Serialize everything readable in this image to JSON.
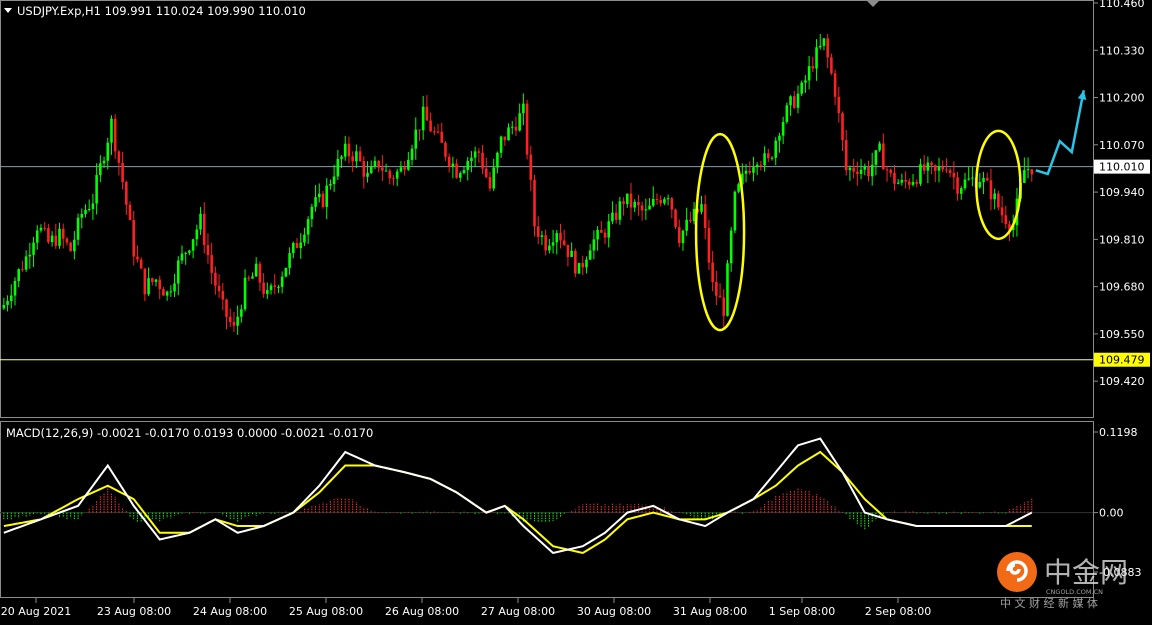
{
  "header": {
    "symbol_line": "USDJPY.Exp,H1  109.991 110.024 109.990 110.010"
  },
  "macd_header": "MACD(12,26,9) -0.0021 -0.0170 0.0193 0.0000 -0.0021 -0.0170",
  "watermark": {
    "brand": "中金网",
    "domain": "CNGOLD.COM.CN",
    "tagline": "中 文 财 经 新 媒 体"
  },
  "colors": {
    "background": "#000000",
    "bull_candle": "#00ff00",
    "bear_candle": "#ff2020",
    "macd_line": "#ffffff",
    "signal_line": "#ffff00",
    "hist_pos": "#ff3030",
    "hist_neg": "#00ff00",
    "ellipse": "#ffff00",
    "forecast_arrow": "#29c5e6",
    "price_line": "#7f9fb3",
    "support_line": "#ffff80"
  },
  "chart_data": [
    {
      "type": "candlestick",
      "title": "USDJPY.Exp,H1",
      "ohlc_last": {
        "open": 109.991,
        "high": 110.024,
        "low": 109.99,
        "close": 110.01
      },
      "ylim": [
        109.36,
        110.46
      ],
      "y_ticks": [
        "110.460",
        "110.330",
        "110.200",
        "110.070",
        "109.940",
        "109.810",
        "109.680",
        "109.550",
        "109.420"
      ],
      "x_ticks": [
        "20 Aug 2021",
        "23 Aug 08:00",
        "24 Aug 08:00",
        "25 Aug 08:00",
        "26 Aug 08:00",
        "27 Aug 08:00",
        "30 Aug 08:00",
        "31 Aug 08:00",
        "1 Sep 08:00",
        "2 Sep 08:00"
      ],
      "current_price": {
        "value": 110.01,
        "label": "110.010"
      },
      "support_level": {
        "value": 109.479,
        "label": "109.479"
      },
      "price_path": [
        [
          0,
          109.63
        ],
        [
          3,
          109.7
        ],
        [
          6,
          109.76
        ],
        [
          9,
          109.85
        ],
        [
          12,
          109.8
        ],
        [
          15,
          109.82
        ],
        [
          18,
          109.78
        ],
        [
          21,
          109.88
        ],
        [
          24,
          109.92
        ],
        [
          27,
          110.05
        ],
        [
          29,
          110.13
        ],
        [
          32,
          109.97
        ],
        [
          35,
          109.78
        ],
        [
          38,
          109.68
        ],
        [
          41,
          109.7
        ],
        [
          44,
          109.66
        ],
        [
          47,
          109.74
        ],
        [
          50,
          109.8
        ],
        [
          53,
          109.86
        ],
        [
          56,
          109.72
        ],
        [
          59,
          109.62
        ],
        [
          62,
          109.56
        ],
        [
          65,
          109.68
        ],
        [
          68,
          109.72
        ],
        [
          71,
          109.65
        ],
        [
          74,
          109.7
        ],
        [
          77,
          109.76
        ],
        [
          80,
          109.82
        ],
        [
          83,
          109.9
        ],
        [
          86,
          109.92
        ],
        [
          89,
          110.0
        ],
        [
          92,
          110.05
        ],
        [
          95,
          110.04
        ],
        [
          98,
          109.98
        ],
        [
          101,
          110.02
        ],
        [
          104,
          109.98
        ],
        [
          107,
          110.0
        ],
        [
          110,
          110.08
        ],
        [
          113,
          110.15
        ],
        [
          116,
          110.1
        ],
        [
          119,
          110.05
        ],
        [
          122,
          110.0
        ],
        [
          125,
          110.03
        ],
        [
          128,
          110.05
        ],
        [
          131,
          109.95
        ],
        [
          134,
          110.08
        ],
        [
          137,
          110.12
        ],
        [
          140,
          110.16
        ],
        [
          143,
          109.85
        ],
        [
          146,
          109.8
        ],
        [
          149,
          109.84
        ],
        [
          152,
          109.78
        ],
        [
          155,
          109.72
        ],
        [
          158,
          109.8
        ],
        [
          161,
          109.82
        ],
        [
          164,
          109.86
        ],
        [
          167,
          109.92
        ],
        [
          170,
          109.9
        ],
        [
          173,
          109.88
        ],
        [
          176,
          109.92
        ],
        [
          179,
          109.94
        ],
        [
          182,
          109.82
        ],
        [
          185,
          109.86
        ],
        [
          188,
          109.9
        ],
        [
          191,
          109.68
        ],
        [
          194,
          109.62
        ],
        [
          197,
          109.92
        ],
        [
          200,
          110.0
        ],
        [
          203,
          110.04
        ],
        [
          206,
          110.02
        ],
        [
          209,
          110.12
        ],
        [
          212,
          110.18
        ],
        [
          215,
          110.22
        ],
        [
          218,
          110.3
        ],
        [
          221,
          110.35
        ],
        [
          224,
          110.22
        ],
        [
          227,
          110.0
        ],
        [
          230,
          110.01
        ],
        [
          233,
          110.0
        ],
        [
          236,
          110.05
        ],
        [
          239,
          109.98
        ],
        [
          242,
          109.96
        ],
        [
          245,
          109.98
        ],
        [
          248,
          110.0
        ],
        [
          251,
          109.99
        ],
        [
          254,
          110.02
        ],
        [
          257,
          109.96
        ],
        [
          260,
          109.97
        ],
        [
          263,
          109.98
        ],
        [
          266,
          109.94
        ],
        [
          269,
          109.88
        ],
        [
          272,
          109.85
        ],
        [
          275,
          110.0
        ],
        [
          277,
          110.01
        ]
      ],
      "forecast_path": [
        [
          110.0
        ],
        [
          109.99
        ],
        [
          110.08
        ],
        [
          110.05
        ],
        [
          110.22
        ]
      ],
      "annotations": [
        {
          "shape": "ellipse",
          "center_time": 193,
          "center_price": 109.83
        },
        {
          "shape": "ellipse",
          "center_time": 268,
          "center_price": 109.96
        }
      ]
    },
    {
      "type": "macd",
      "title": "MACD(12,26,9)",
      "params": [
        12,
        26,
        9
      ],
      "header_values": [
        -0.0021,
        -0.017,
        0.0193,
        0.0,
        -0.0021,
        -0.017
      ],
      "ylim": [
        -0.0883,
        0.1198
      ],
      "y_ticks": [
        "0.1198",
        "0.00",
        "-0.0883"
      ],
      "macd_path": [
        [
          0,
          -0.03
        ],
        [
          10,
          -0.01
        ],
        [
          20,
          0.01
        ],
        [
          28,
          0.07
        ],
        [
          35,
          0.01
        ],
        [
          42,
          -0.04
        ],
        [
          50,
          -0.03
        ],
        [
          57,
          -0.01
        ],
        [
          63,
          -0.03
        ],
        [
          70,
          -0.02
        ],
        [
          78,
          0.0
        ],
        [
          85,
          0.04
        ],
        [
          92,
          0.09
        ],
        [
          100,
          0.07
        ],
        [
          108,
          0.06
        ],
        [
          115,
          0.05
        ],
        [
          122,
          0.03
        ],
        [
          130,
          0.0
        ],
        [
          135,
          0.01
        ],
        [
          140,
          -0.02
        ],
        [
          148,
          -0.06
        ],
        [
          156,
          -0.05
        ],
        [
          162,
          -0.03
        ],
        [
          168,
          0.0
        ],
        [
          175,
          0.01
        ],
        [
          182,
          -0.01
        ],
        [
          189,
          -0.02
        ],
        [
          195,
          0.0
        ],
        [
          202,
          0.02
        ],
        [
          208,
          0.06
        ],
        [
          214,
          0.1
        ],
        [
          220,
          0.11
        ],
        [
          226,
          0.06
        ],
        [
          232,
          0.0
        ],
        [
          238,
          -0.01
        ],
        [
          246,
          -0.02
        ],
        [
          254,
          -0.02
        ],
        [
          262,
          -0.02
        ],
        [
          270,
          -0.02
        ],
        [
          277,
          0.0
        ]
      ],
      "signal_path": [
        [
          0,
          -0.02
        ],
        [
          10,
          -0.01
        ],
        [
          20,
          0.02
        ],
        [
          28,
          0.04
        ],
        [
          35,
          0.02
        ],
        [
          42,
          -0.03
        ],
        [
          50,
          -0.03
        ],
        [
          57,
          -0.01
        ],
        [
          63,
          -0.02
        ],
        [
          70,
          -0.02
        ],
        [
          78,
          0.0
        ],
        [
          85,
          0.03
        ],
        [
          92,
          0.07
        ],
        [
          100,
          0.07
        ],
        [
          108,
          0.06
        ],
        [
          115,
          0.05
        ],
        [
          122,
          0.03
        ],
        [
          130,
          0.0
        ],
        [
          135,
          0.01
        ],
        [
          140,
          -0.01
        ],
        [
          148,
          -0.05
        ],
        [
          156,
          -0.06
        ],
        [
          162,
          -0.04
        ],
        [
          168,
          -0.01
        ],
        [
          175,
          0.0
        ],
        [
          182,
          -0.01
        ],
        [
          189,
          -0.01
        ],
        [
          195,
          0.0
        ],
        [
          202,
          0.02
        ],
        [
          208,
          0.04
        ],
        [
          214,
          0.07
        ],
        [
          220,
          0.09
        ],
        [
          226,
          0.06
        ],
        [
          232,
          0.02
        ],
        [
          238,
          -0.01
        ],
        [
          246,
          -0.02
        ],
        [
          254,
          -0.02
        ],
        [
          262,
          -0.02
        ],
        [
          270,
          -0.02
        ],
        [
          277,
          -0.02
        ]
      ]
    }
  ]
}
